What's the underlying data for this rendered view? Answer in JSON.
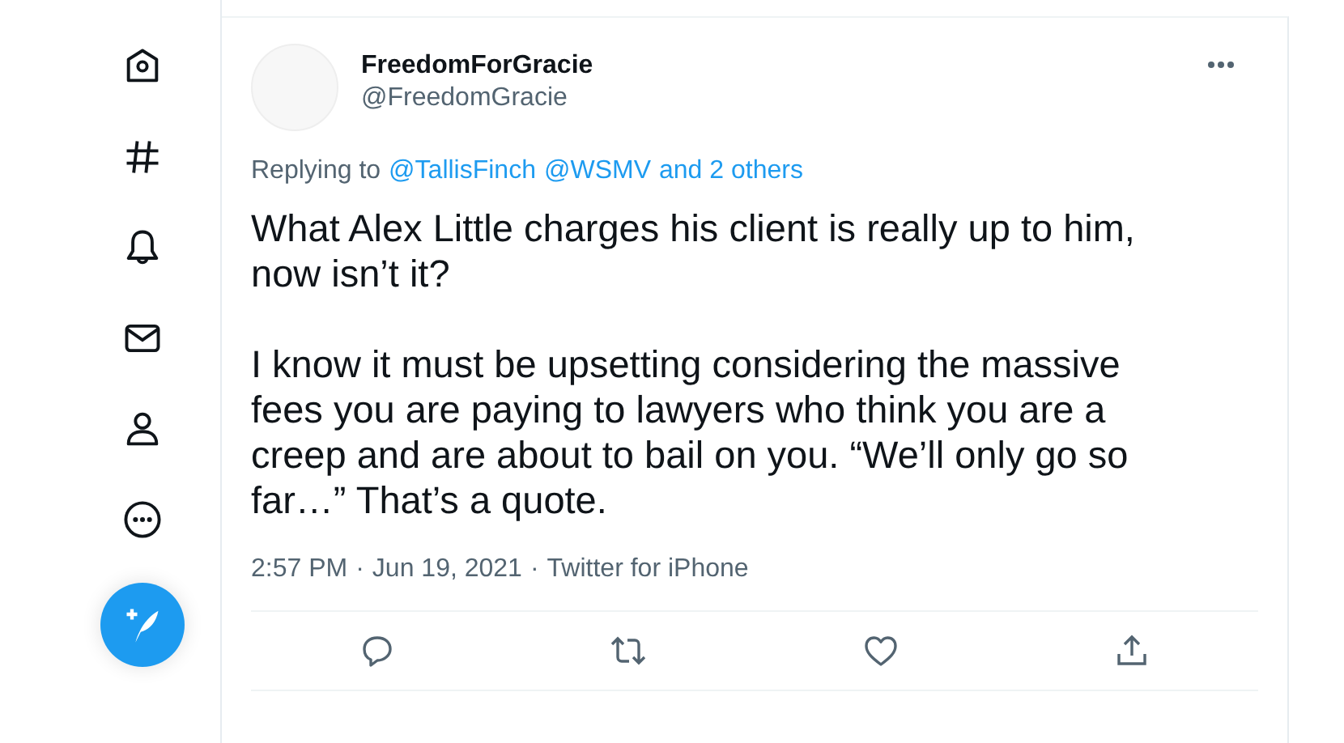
{
  "tweet": {
    "name": "FreedomForGracie",
    "handle": "@FreedomGracie",
    "replying_prefix": "Replying to",
    "replying_to": [
      "@TallisFinch",
      "@WSMV",
      "and 2 others"
    ],
    "paragraphs": [
      "What Alex Little charges his client is really up to him, now isn’t it?",
      "I know it must be upsetting considering the massive fees you are paying to lawyers who think you are a creep and are about to bail on you. “We’ll only go so far…” That’s a quote."
    ],
    "time": "2:57 PM",
    "date": "Jun 19, 2021",
    "source": "Twitter for iPhone",
    "separator": "·"
  }
}
